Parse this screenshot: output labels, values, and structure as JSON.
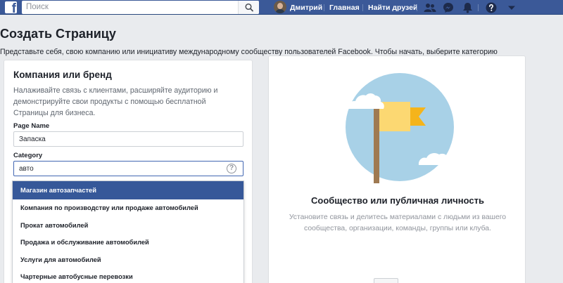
{
  "topbar": {
    "logo_letter": "f",
    "search_placeholder": "Поиск",
    "user_name": "Дмитрий",
    "home_label": "Главная",
    "find_friends_label": "Найти друзей",
    "icons": [
      "friends-icon",
      "messenger-icon",
      "notifications-icon",
      "help-icon",
      "menu-caret-icon"
    ]
  },
  "page": {
    "title": "Создать Страницу",
    "subtitle": "Представьте себя, свою компанию или инициативу международному сообществу пользователей Facebook. Чтобы начать, выберите категорию"
  },
  "business_card": {
    "title": "Компания или бренд",
    "description": "Налаживайте связь с клиентами, расширяйте аудиторию и демонстрируйте свои продукты с помощью бесплатной Страницы для бизнеса.",
    "page_name_label": "Page Name",
    "page_name_value": "Запаска",
    "category_label": "Category",
    "category_value": "авто",
    "help_glyph": "?",
    "suggestions": [
      "Магазин автозапчастей",
      "Компания по производству или продаже автомобилей",
      "Прокат автомобилей",
      "Продажа и обслуживание автомобилей",
      "Услуги для автомобилей",
      "Чартерные автобусные перевозки"
    ]
  },
  "community_card": {
    "title": "Сообщество или публичная личность",
    "description": "Установите связь и делитесь материалами с людьми из вашего сообщества, организации, команды, группы или клуба."
  },
  "colors": {
    "brand_blue": "#3b5998",
    "selected_item": "#365899",
    "background": "#e9ebee",
    "illustration_circle": "#a8d1e7",
    "flag_yellow": "#fcd872"
  }
}
